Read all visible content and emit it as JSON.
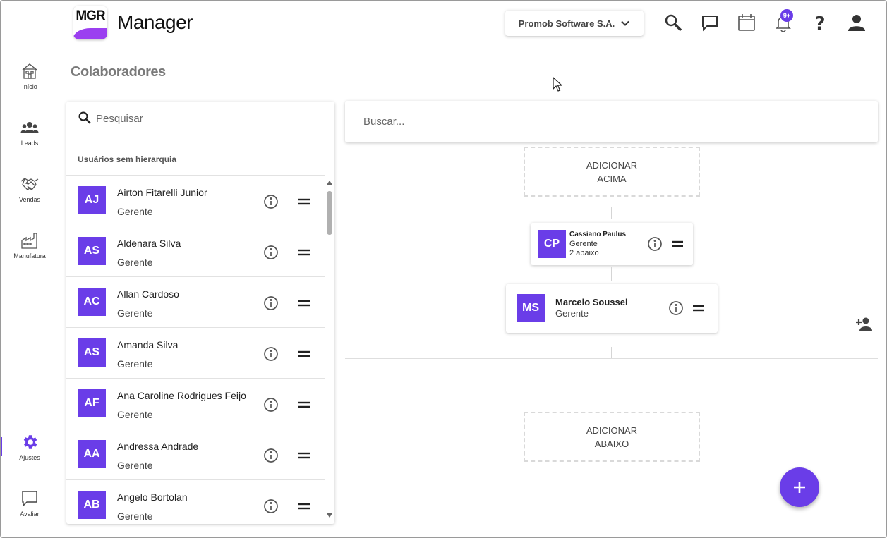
{
  "colors": {
    "accent": "#6a3de8",
    "logo_swoosh": "#9b3ff0"
  },
  "sidebar": {
    "items": [
      {
        "label": "Início",
        "icon": "home-icon"
      },
      {
        "label": "Leads",
        "icon": "people-icon"
      },
      {
        "label": "Vendas",
        "icon": "handshake-icon"
      },
      {
        "label": "Manufatura",
        "icon": "factory-icon"
      },
      {
        "label": "Ajustes",
        "icon": "gear-icon",
        "active": true
      },
      {
        "label": "Avaliar",
        "icon": "feedback-icon"
      }
    ]
  },
  "header": {
    "logo_text": "MGR",
    "app_title": "Manager",
    "company": "Promob Software S.A.",
    "notification_badge": "9+"
  },
  "page": {
    "title": "Colaboradores"
  },
  "left_panel": {
    "search_placeholder": "Pesquisar",
    "section_title": "Usuários sem hierarquia",
    "users": [
      {
        "initials": "AJ",
        "name": "Airton Fitarelli Junior",
        "role": "Gerente"
      },
      {
        "initials": "AS",
        "name": "Aldenara Silva",
        "role": "Gerente"
      },
      {
        "initials": "AC",
        "name": "Allan Cardoso",
        "role": "Gerente"
      },
      {
        "initials": "AS",
        "name": "Amanda Silva",
        "role": "Gerente"
      },
      {
        "initials": "AF",
        "name": "Ana Caroline Rodrigues Feijo",
        "role": "Gerente"
      },
      {
        "initials": "AA",
        "name": "Andressa Andrade",
        "role": "Gerente"
      },
      {
        "initials": "AB",
        "name": "Angelo Bortolan",
        "role": "Gerente"
      }
    ]
  },
  "right_panel": {
    "search_placeholder": "Buscar...",
    "add_above": {
      "line1": "ADICIONAR",
      "line2": "ACIMA"
    },
    "add_below": {
      "line1": "ADICIONAR",
      "line2": "ABAIXO"
    },
    "parent_node": {
      "initials": "CP",
      "name": "Cassiano Paulus",
      "role": "Gerente",
      "sub": "2 abaixo"
    },
    "current_node": {
      "initials": "MS",
      "name": "Marcelo Soussel",
      "role": "Gerente"
    }
  }
}
